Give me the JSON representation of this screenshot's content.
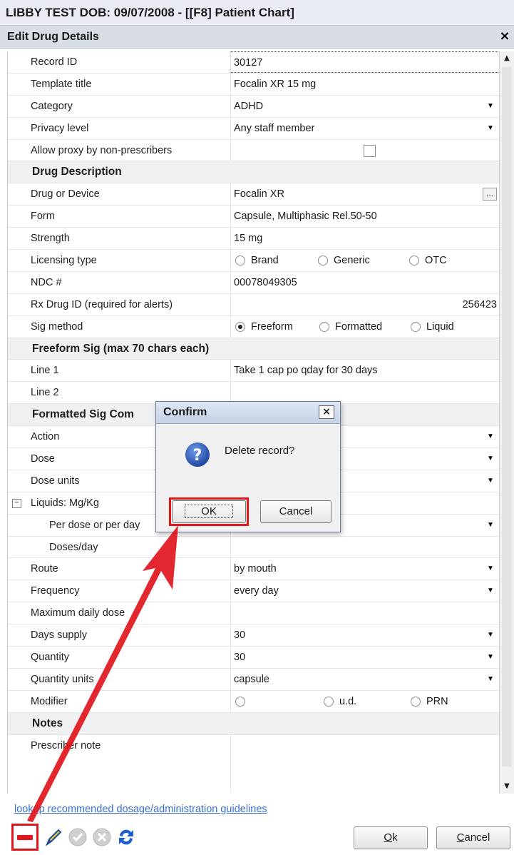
{
  "window": {
    "title": "LIBBY TEST  DOB: 09/07/2008 - [[F8] Patient Chart]"
  },
  "dialog": {
    "title": "Edit Drug Details",
    "close": "×"
  },
  "rows": {
    "record_id": {
      "label": "Record ID",
      "value": "30127"
    },
    "template_title": {
      "label": "Template title",
      "value": "Focalin XR 15 mg"
    },
    "category": {
      "label": "Category",
      "value": "ADHD"
    },
    "privacy": {
      "label": "Privacy level",
      "value": "Any staff member"
    },
    "proxy": {
      "label": "Allow proxy by non-prescribers"
    },
    "sec_drug": {
      "label": "Drug Description"
    },
    "drug": {
      "label": "Drug or Device",
      "value": "Focalin XR",
      "btn": "..."
    },
    "form": {
      "label": "Form",
      "value": "Capsule, Multiphasic Rel.50-50"
    },
    "strength": {
      "label": "Strength",
      "value": "15 mg"
    },
    "licensing": {
      "label": "Licensing type",
      "opt1": "Brand",
      "opt2": "Generic",
      "opt3": "OTC"
    },
    "ndc": {
      "label": "NDC #",
      "value": "00078049305"
    },
    "rxid": {
      "label": "Rx Drug ID (required for alerts)",
      "value": "256423"
    },
    "sig_method": {
      "label": "Sig method",
      "opt1": "Freeform",
      "opt2": "Formatted",
      "opt3": "Liquid"
    },
    "sec_freeform": {
      "label": "Freeform Sig (max 70 chars each)"
    },
    "line1": {
      "label": "Line 1",
      "value": "Take 1 cap po qday for 30 days"
    },
    "line2": {
      "label": "Line 2"
    },
    "sec_formatted": {
      "label": "Formatted Sig Com"
    },
    "action": {
      "label": "Action"
    },
    "dose": {
      "label": "Dose"
    },
    "dose_units": {
      "label": "Dose units"
    },
    "liquids": {
      "label": "Liquids: Mg/Kg",
      "toggle": "−"
    },
    "per_dose": {
      "label": "Per dose or per day"
    },
    "doses_day": {
      "label": "Doses/day"
    },
    "route": {
      "label": "Route",
      "value": "by mouth"
    },
    "frequency": {
      "label": "Frequency",
      "value": "every day"
    },
    "max_daily": {
      "label": "Maximum daily dose"
    },
    "days_supply": {
      "label": "Days supply",
      "value": "30"
    },
    "quantity": {
      "label": "Quantity",
      "value": "30"
    },
    "quantity_units": {
      "label": "Quantity units",
      "value": "capsule"
    },
    "modifier": {
      "label": "Modifier",
      "opt2": "u.d.",
      "opt3": "PRN"
    },
    "sec_notes": {
      "label": "Notes"
    },
    "prescriber_note": {
      "label": "Prescriber note"
    }
  },
  "link": "lookup recommended dosage/administration guidelines",
  "buttons": {
    "ok_key": "O",
    "ok_rest": "k",
    "cancel_key": "C",
    "cancel_rest": "ancel"
  },
  "confirm": {
    "title": "Confirm",
    "message": "Delete record?",
    "ok": "OK",
    "cancel": "Cancel",
    "close": "×"
  },
  "colors": {
    "highlight": "#e0161c",
    "link": "#3d6fcf"
  }
}
